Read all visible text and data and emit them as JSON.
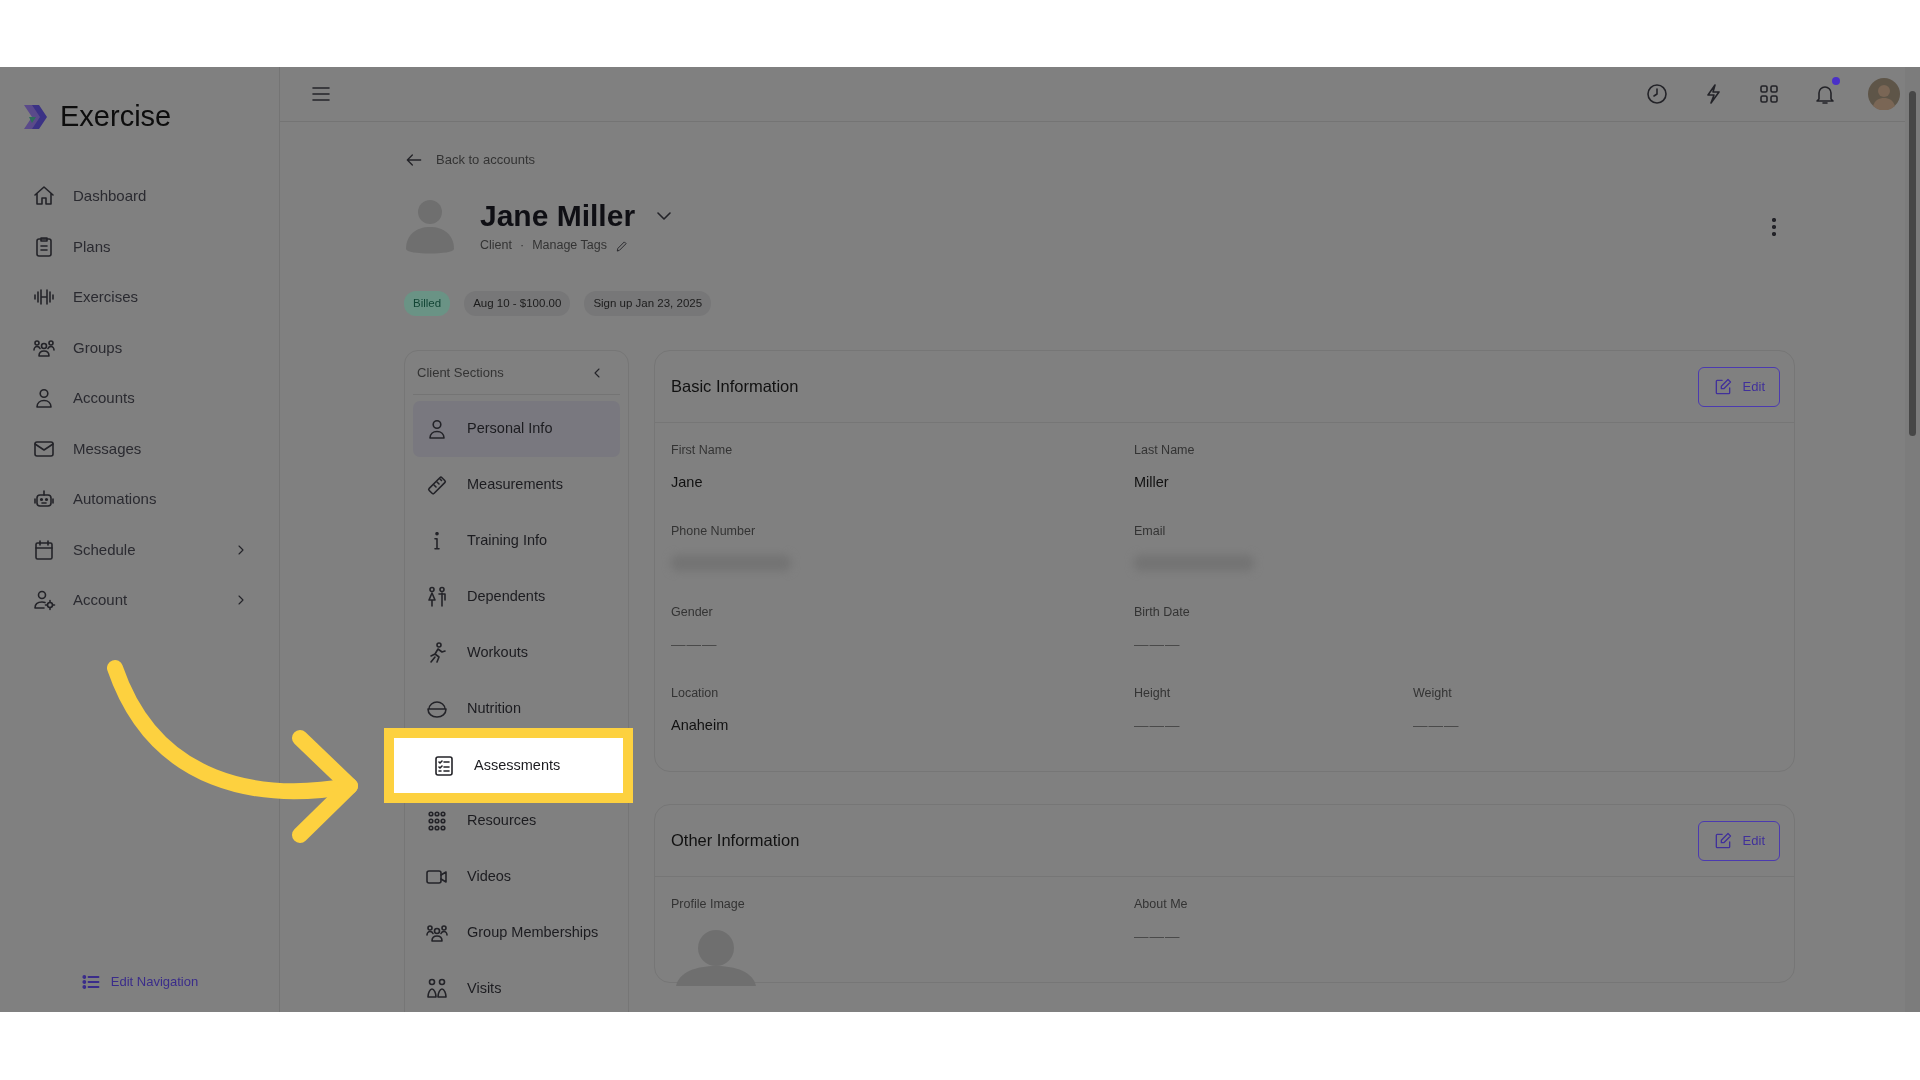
{
  "sidebar": {
    "brand": "Exercise",
    "items": [
      {
        "label": "Dashboard",
        "expandable": false
      },
      {
        "label": "Plans",
        "expandable": false
      },
      {
        "label": "Exercises",
        "expandable": false
      },
      {
        "label": "Groups",
        "expandable": false
      },
      {
        "label": "Accounts",
        "expandable": false
      },
      {
        "label": "Messages",
        "expandable": false
      },
      {
        "label": "Automations",
        "expandable": false
      },
      {
        "label": "Schedule",
        "expandable": true
      },
      {
        "label": "Account",
        "expandable": true
      }
    ],
    "edit_link": "Edit Navigation"
  },
  "topbar": {
    "has_notification": true
  },
  "back_link": "Back to accounts",
  "profile": {
    "name": "Jane Miller",
    "role": "Client",
    "separator": "·",
    "tags_link": "Manage Tags"
  },
  "badges": [
    {
      "label": "Billed",
      "kind": "status"
    },
    {
      "label": "Aug 10 - $100.00",
      "kind": "info"
    },
    {
      "label": "Sign up Jan 23, 2025",
      "kind": "info"
    }
  ],
  "client_sections": {
    "title": "Client Sections",
    "items": [
      {
        "label": "Personal Info",
        "selected": true,
        "highlighted": false
      },
      {
        "label": "Measurements",
        "selected": false,
        "highlighted": false
      },
      {
        "label": "Training Info",
        "selected": false,
        "highlighted": false
      },
      {
        "label": "Dependents",
        "selected": false,
        "highlighted": false
      },
      {
        "label": "Workouts",
        "selected": false,
        "highlighted": false
      },
      {
        "label": "Nutrition",
        "selected": false,
        "highlighted": false
      },
      {
        "label": "Assessments",
        "selected": false,
        "highlighted": true
      },
      {
        "label": "Resources",
        "selected": false,
        "highlighted": false
      },
      {
        "label": "Videos",
        "selected": false,
        "highlighted": false
      },
      {
        "label": "Group Memberships",
        "selected": false,
        "highlighted": false
      },
      {
        "label": "Visits",
        "selected": false,
        "highlighted": false
      }
    ]
  },
  "cards": [
    {
      "title": "Basic Information",
      "edit": "Edit",
      "rows": [
        [
          {
            "label": "First Name",
            "kind": "value",
            "value": "Jane"
          },
          {
            "label": "Last Name",
            "kind": "value",
            "value": "Miller"
          }
        ],
        [
          {
            "label": "Phone Number",
            "kind": "redacted"
          },
          {
            "label": "Email",
            "kind": "redacted"
          }
        ],
        [
          {
            "label": "Gender",
            "kind": "empty",
            "value": "———"
          },
          {
            "label": "Birth Date",
            "kind": "empty",
            "value": "———"
          }
        ],
        [
          {
            "label": "Location",
            "kind": "value",
            "value": "Anaheim"
          },
          {
            "label": "Height",
            "kind": "empty",
            "value": "———"
          },
          {
            "label": "Weight",
            "kind": "empty",
            "value": "———"
          }
        ]
      ]
    },
    {
      "title": "Other Information",
      "edit": "Edit",
      "rows": [
        [
          {
            "label": "Profile Image",
            "kind": "image"
          },
          {
            "label": "About Me",
            "kind": "empty",
            "value": "———"
          }
        ]
      ]
    }
  ]
}
